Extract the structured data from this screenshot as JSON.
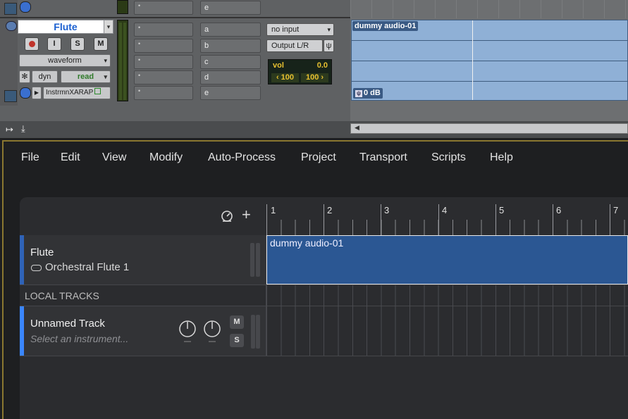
{
  "protools": {
    "track": {
      "name": "Flute",
      "record_label": "",
      "input_monitor_label": "I",
      "solo_label": "S",
      "mute_label": "M",
      "view_mode": "waveform",
      "dyn_label": "dyn",
      "automation_mode": "read",
      "instrument_plugin": "InstrmnXARAP"
    },
    "sends_above": "e",
    "send_letters": [
      "a",
      "b",
      "c",
      "d",
      "e"
    ],
    "input": "no input",
    "output": "Output L/R",
    "volume": {
      "label": "vol",
      "value": "0.0"
    },
    "pan": {
      "left": "‹ 100",
      "right": "100 ›"
    },
    "clip": {
      "name": "dummy audio-01",
      "gain": "0 dB"
    }
  },
  "app": {
    "menu": [
      "File",
      "Edit",
      "View",
      "Modify",
      "Auto-Process",
      "Project",
      "Transport",
      "Scripts",
      "Help"
    ],
    "ruler_bars": [
      "1",
      "2",
      "3",
      "4",
      "5",
      "6",
      "7"
    ],
    "tracks": [
      {
        "name": "Flute",
        "instrument": "Orchestral Flute 1"
      }
    ],
    "local_tracks_label": "LOCAL TRACKS",
    "local_tracks": [
      {
        "name": "Unnamed Track",
        "instrument_placeholder": "Select an instrument...",
        "mute_label": "M",
        "solo_label": "S"
      }
    ],
    "clip": {
      "name": "dummy audio-01"
    },
    "colors": {
      "accent": "#3a86ff",
      "clip": "#2b5793",
      "menu_text": "#e3e3e3"
    }
  }
}
